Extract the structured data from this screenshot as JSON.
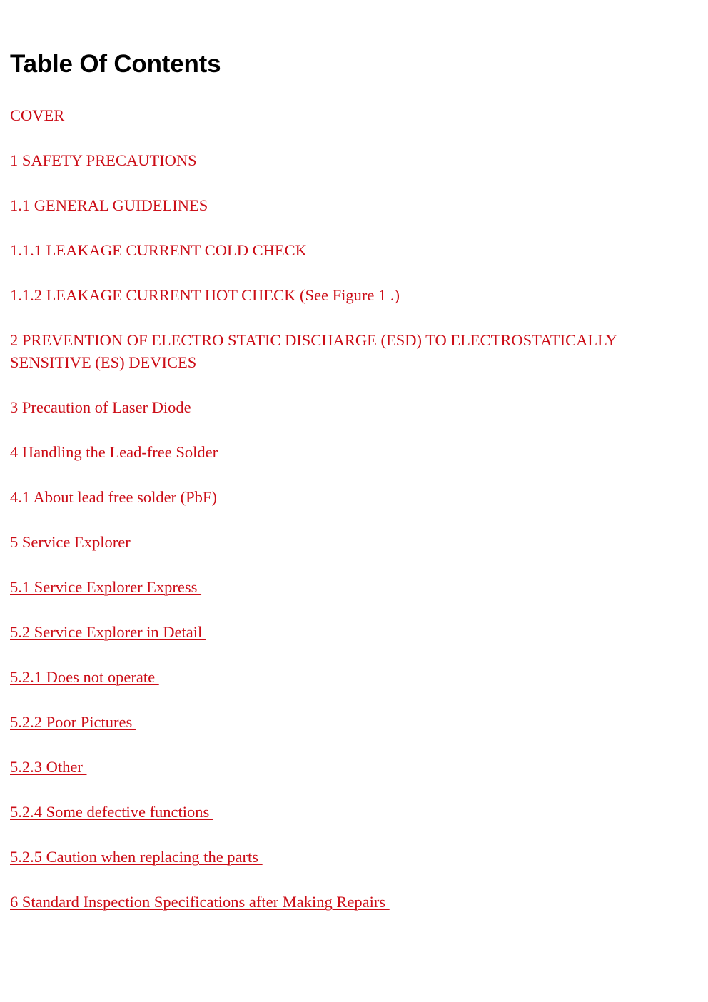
{
  "document": {
    "title": "Table Of Contents",
    "background_color": "#ffffff",
    "link_color": "#cc0d17",
    "title_color": "#000000"
  },
  "toc": {
    "entries": [
      {
        "label": "COVER"
      },
      {
        "label": "1 SAFETY PRECAUTIONS "
      },
      {
        "label": "1.1 GENERAL GUIDELINES "
      },
      {
        "label": "1.1.1 LEAKAGE CURRENT COLD CHECK "
      },
      {
        "label": "1.1.2 LEAKAGE CURRENT HOT CHECK (See Figure 1 .) "
      },
      {
        "label": "2 PREVENTION OF ELECTRO STATIC DISCHARGE (ESD) TO ELECTROSTATICALLY SENSITIVE (ES) DEVICES "
      },
      {
        "label": "3 Precaution of Laser Diode "
      },
      {
        "label": "4 Handling the Lead-free Solder "
      },
      {
        "label": "4.1 About lead free solder (PbF) "
      },
      {
        "label": "5 Service Explorer "
      },
      {
        "label": "5.1 Service Explorer Express "
      },
      {
        "label": "5.2 Service Explorer in Detail "
      },
      {
        "label": "5.2.1 Does not operate "
      },
      {
        "label": "5.2.2 Poor Pictures "
      },
      {
        "label": "5.2.3 Other "
      },
      {
        "label": "5.2.4 Some defective functions "
      },
      {
        "label": "5.2.5 Caution when replacing the parts "
      },
      {
        "label": "6 Standard Inspection Specifications after Making Repairs "
      }
    ]
  }
}
